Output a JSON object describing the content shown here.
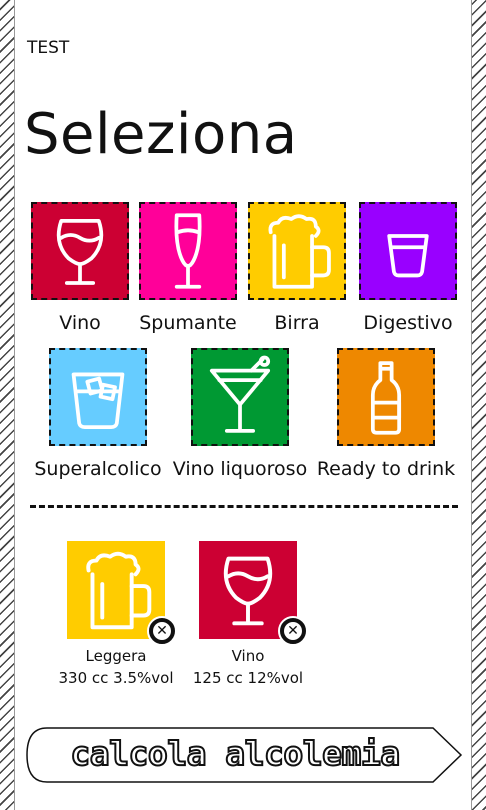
{
  "app": {
    "title": "TEST"
  },
  "page": {
    "title": "Seleziona"
  },
  "drinks": [
    {
      "label": "Vino",
      "icon": "wine-glass-icon",
      "color": "#cc0033"
    },
    {
      "label": "Spumante",
      "icon": "flute-glass-icon",
      "color": "#ff0099"
    },
    {
      "label": "Birra",
      "icon": "beer-mug-icon",
      "color": "#ffcc00"
    },
    {
      "label": "Digestivo",
      "icon": "tumbler-glass-icon",
      "color": "#9900ff"
    },
    {
      "label": "Superalcolico",
      "icon": "ice-glass-icon",
      "color": "#66ccff"
    },
    {
      "label": "Vino liquoroso",
      "icon": "cocktail-glass-icon",
      "color": "#009933"
    },
    {
      "label": "Ready to drink",
      "icon": "bottle-icon",
      "color": "#ee8800"
    }
  ],
  "selected": [
    {
      "name": "Leggera",
      "detail": "330 cc 3.5%vol",
      "icon": "beer-mug-icon",
      "color": "#ffcc00"
    },
    {
      "name": "Vino",
      "detail": "125 cc 12%vol",
      "icon": "wine-glass-icon",
      "color": "#cc0033"
    }
  ],
  "actions": {
    "calculate_label": "calcola alcolemia"
  }
}
